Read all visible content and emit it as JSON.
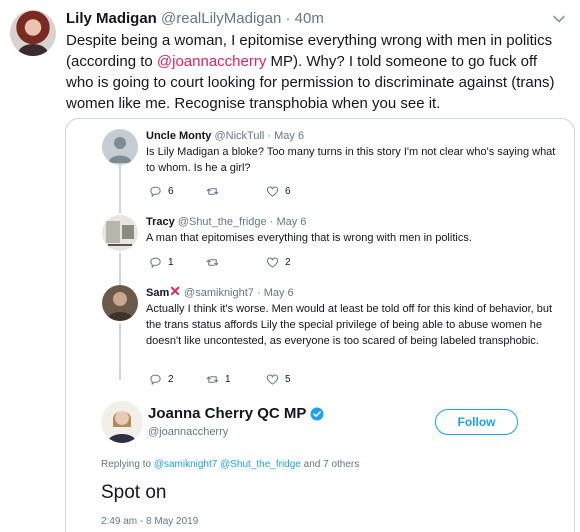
{
  "outer": {
    "name": "Lily Madigan",
    "handle": "@realLilyMadigan",
    "separator": "·",
    "time": "40m",
    "text_before": "Despite being a woman, I epitomise everything wrong with men in politics (according to ",
    "mention": "@joannaccherry",
    "text_after": " MP). Why? I told someone to go fuck off who is going to court looking for permission to discriminate against (trans) women like me. Recognise transphobia when you see it."
  },
  "replies": [
    {
      "name": "Uncle Monty",
      "handle": "@NickTull",
      "separator": "·",
      "date": "May 6",
      "text": "Is Lily Madigan a bloke? Too many turns in this story I'm not clear who's saying what to whom. Is he a girl?",
      "reply_count": "6",
      "retweet_count": "",
      "like_count": "6"
    },
    {
      "name": "Tracy",
      "handle": "@Shut_the_fridge",
      "separator": "·",
      "date": "May 6",
      "text": "A man that epitomises everything that is wrong with men in politics.",
      "reply_count": "1",
      "retweet_count": "",
      "like_count": "2"
    },
    {
      "name": "Sam",
      "name_symbol": "✕",
      "handle": "@samiknight7",
      "separator": "·",
      "date": "May 6",
      "text": "Actually I think it's worse. Men would at least be told off for this kind of behavior, but the trans status affords Lily the special privilege of being able to abuse women he doesn't like uncontested, as everyone is too scared of being labeled transphobic.",
      "reply_count": "2",
      "retweet_count": "1",
      "like_count": "5"
    }
  ],
  "main_tweet": {
    "name": "Joanna Cherry QC MP",
    "handle": "@joannaccherry",
    "follow_label": "Follow",
    "replying_prefix": "Replying to ",
    "replying_user1": "@samiknight7",
    "replying_user2": "@Shut_the_fridge",
    "replying_suffix": " and 7 others",
    "text": "Spot on",
    "timestamp": "2:49 am - 8 May 2019"
  },
  "colors": {
    "accent": "#1da1f2",
    "mention": "#e0245e",
    "secondary_text": "#657786",
    "border": "#ccd6dd",
    "verified": "#1da1f2"
  },
  "icons": [
    "chevron-down-icon",
    "reply-icon",
    "retweet-icon",
    "like-icon",
    "verified-badge-icon"
  ]
}
